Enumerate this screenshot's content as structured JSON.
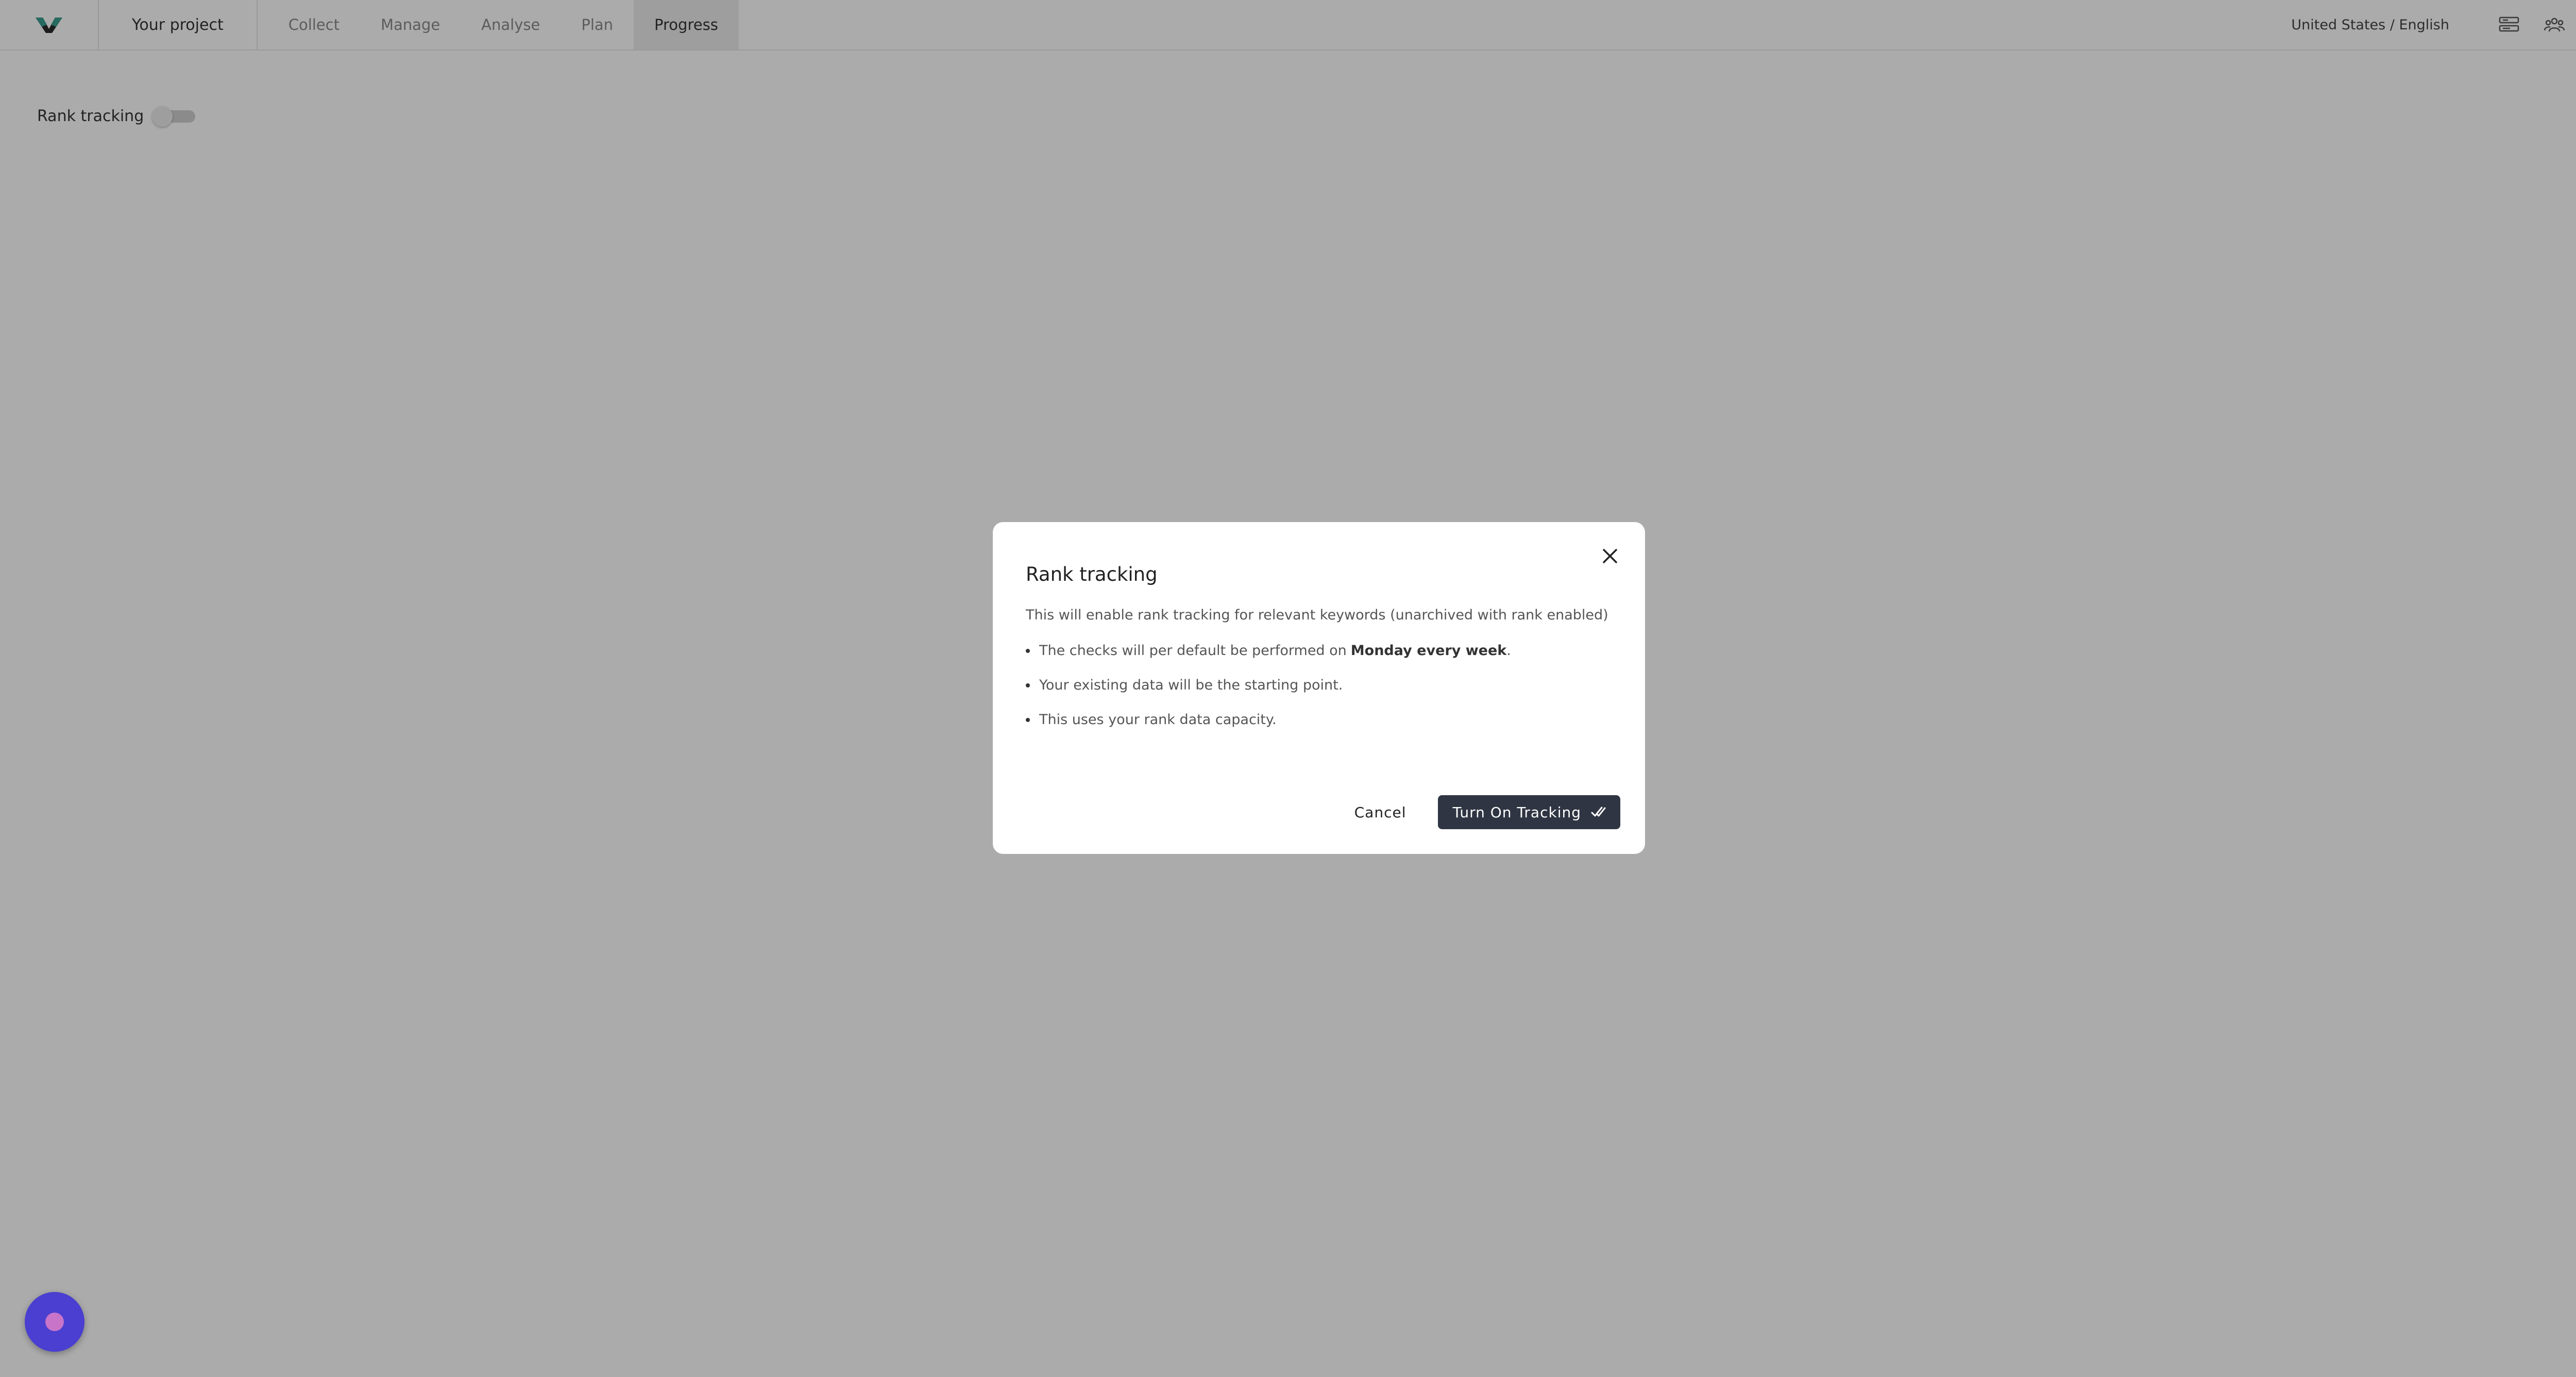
{
  "header": {
    "project": "Your project",
    "nav": [
      "Collect",
      "Manage",
      "Analyse",
      "Plan",
      "Progress"
    ],
    "active_nav": "Progress",
    "locale": "United States / English"
  },
  "page": {
    "rank_tracking_label": "Rank tracking",
    "rank_tracking_enabled": false
  },
  "modal": {
    "title": "Rank tracking",
    "intro": "This will enable rank tracking for relevant keywords (unarchived with rank enabled)",
    "bullet1_pre": "The checks will per default be performed on",
    "bullet1_bold": "Monday every week",
    "bullet1_post": ".",
    "bullet2": "Your existing data will be the starting point.",
    "bullet3": "This uses your rank data capacity.",
    "cancel_label": "Cancel",
    "confirm_label": "Turn On Tracking"
  },
  "colors": {
    "primary_button": "#2f3542",
    "chat_bubble": "#4a3fd0"
  }
}
